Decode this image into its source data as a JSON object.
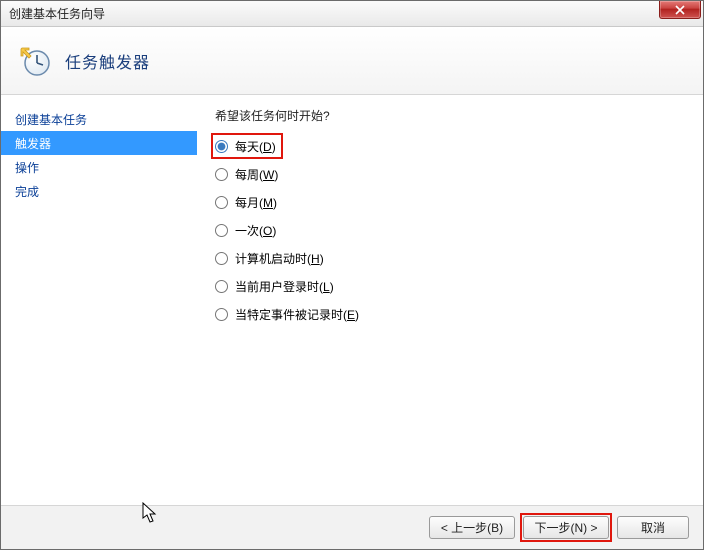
{
  "window": {
    "title": "创建基本任务向导"
  },
  "header": {
    "title": "任务触发器"
  },
  "sidebar": {
    "items": [
      {
        "label": "创建基本任务"
      },
      {
        "label": "触发器"
      },
      {
        "label": "操作"
      },
      {
        "label": "完成"
      }
    ]
  },
  "content": {
    "prompt": "希望该任务何时开始?",
    "options": {
      "daily": {
        "text": "每天",
        "accel": "D",
        "checked": true
      },
      "weekly": {
        "text": "每周",
        "accel": "W",
        "checked": false
      },
      "monthly": {
        "text": "每月",
        "accel": "M",
        "checked": false
      },
      "once": {
        "text": "一次",
        "accel": "O",
        "checked": false
      },
      "startup": {
        "text": "计算机启动时",
        "accel": "H",
        "checked": false
      },
      "logon": {
        "text": "当前用户登录时",
        "accel": "L",
        "checked": false
      },
      "event": {
        "text": "当特定事件被记录时",
        "accel": "E",
        "checked": false
      }
    }
  },
  "footer": {
    "back": {
      "label": "< 上一步(B)"
    },
    "next": {
      "label": "下一步(N) >"
    },
    "cancel": {
      "label": "取消"
    }
  }
}
